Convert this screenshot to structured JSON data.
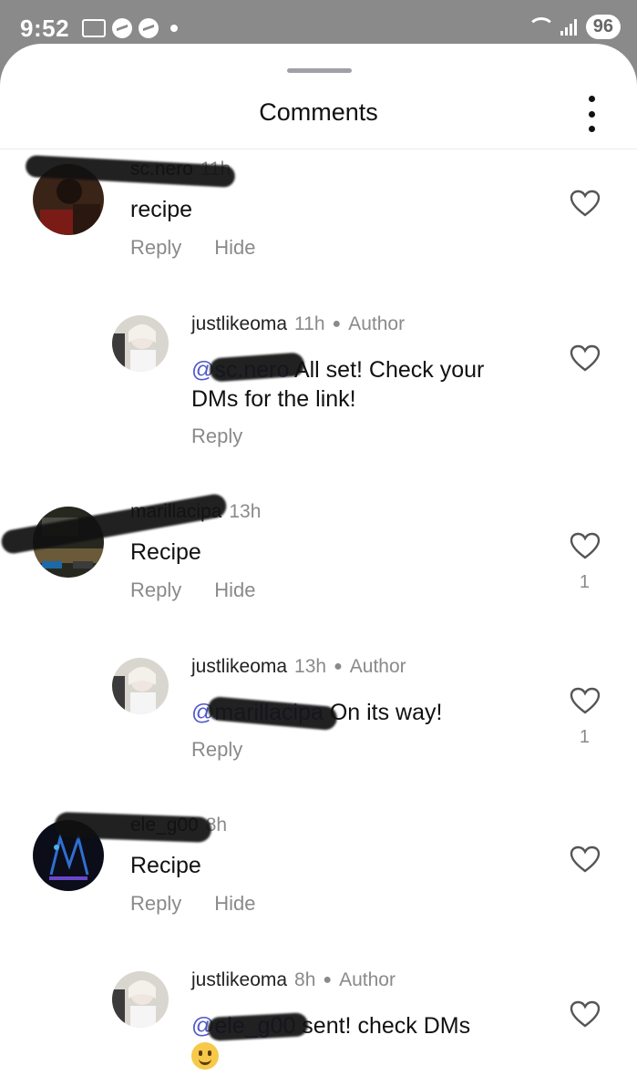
{
  "status_bar": {
    "time": "9:52",
    "battery": "96"
  },
  "sheet": {
    "title": "Comments"
  },
  "comments": [
    {
      "username": "sc.nero",
      "time": "11h",
      "text": "recipe",
      "reply_label": "Reply",
      "hide_label": "Hide",
      "likes": ""
    },
    {
      "username": "justlikeoma",
      "time": "11h",
      "author_label": "Author",
      "mention": "@sc.nero",
      "text": " All set! Check your DMs for the link!",
      "reply_label": "Reply",
      "likes": ""
    },
    {
      "username": "marillacipa",
      "time": "13h",
      "text": "Recipe",
      "reply_label": "Reply",
      "hide_label": "Hide",
      "likes": "1"
    },
    {
      "username": "justlikeoma",
      "time": "13h",
      "author_label": "Author",
      "mention": "@marillacipa",
      "text": " On its way!",
      "reply_label": "Reply",
      "likes": "1"
    },
    {
      "username": "ele_g00",
      "time": "8h",
      "text": "Recipe",
      "reply_label": "Reply",
      "hide_label": "Hide",
      "likes": ""
    },
    {
      "username": "justlikeoma",
      "time": "8h",
      "author_label": "Author",
      "mention": "@ele_g00",
      "text": " sent! check DMs",
      "reply_label": "Reply",
      "likes": ""
    }
  ]
}
